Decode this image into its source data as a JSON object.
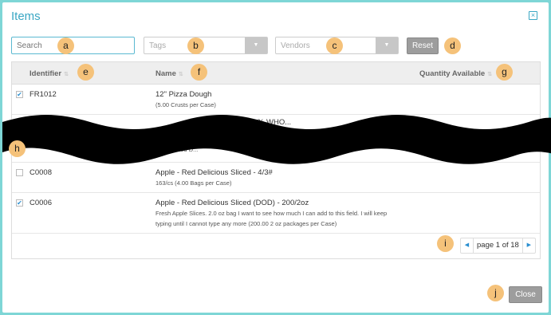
{
  "modal": {
    "title": "Items",
    "close_x": "×"
  },
  "filters": {
    "search_placeholder": "Search",
    "tags_placeholder": "Tags",
    "vendors_placeholder": "Vendors",
    "dropdown_arrow": "▼",
    "reset_label": "Reset"
  },
  "table": {
    "headers": {
      "identifier": "Identifier",
      "name": "Name",
      "quantity": "Quantity Available",
      "sort_glyph": "⇅"
    },
    "rows": [
      {
        "checked": true,
        "identifier": "FR1012",
        "name": "12\" Pizza Dough",
        "sub": [
          "(5.00 Crusts per Case)"
        ]
      },
      {
        "checked": false,
        "identifier": "C0008",
        "name": "Apple - Red Delicious Sliced - 4/3#",
        "sub": [
          "163/cs (4.00 Bags per Case)"
        ]
      },
      {
        "checked": true,
        "identifier": "C0006",
        "name": "Apple - Red Delicious Sliced (DOD) - 200/2oz",
        "sub": [
          "Fresh Apple Slices. 2.0 oz bag I want to see how much I can add to this field. I will keep",
          "typing until I cannot type any more (200.00 2 oz packages per Case)"
        ]
      }
    ],
    "obscured_fragments": {
      "row2_name": "...% WHO...",
      "row2_sub": "Apple - Red D...",
      "row2_sub_right": "...Bags per Case)"
    }
  },
  "pagination": {
    "prev": "◀",
    "text": "page 1 of 18",
    "next": "▶"
  },
  "footer": {
    "close_label": "Close"
  },
  "callouts": [
    "a",
    "b",
    "c",
    "d",
    "e",
    "f",
    "g",
    "h",
    "i",
    "j"
  ],
  "check_glyph": "✔"
}
